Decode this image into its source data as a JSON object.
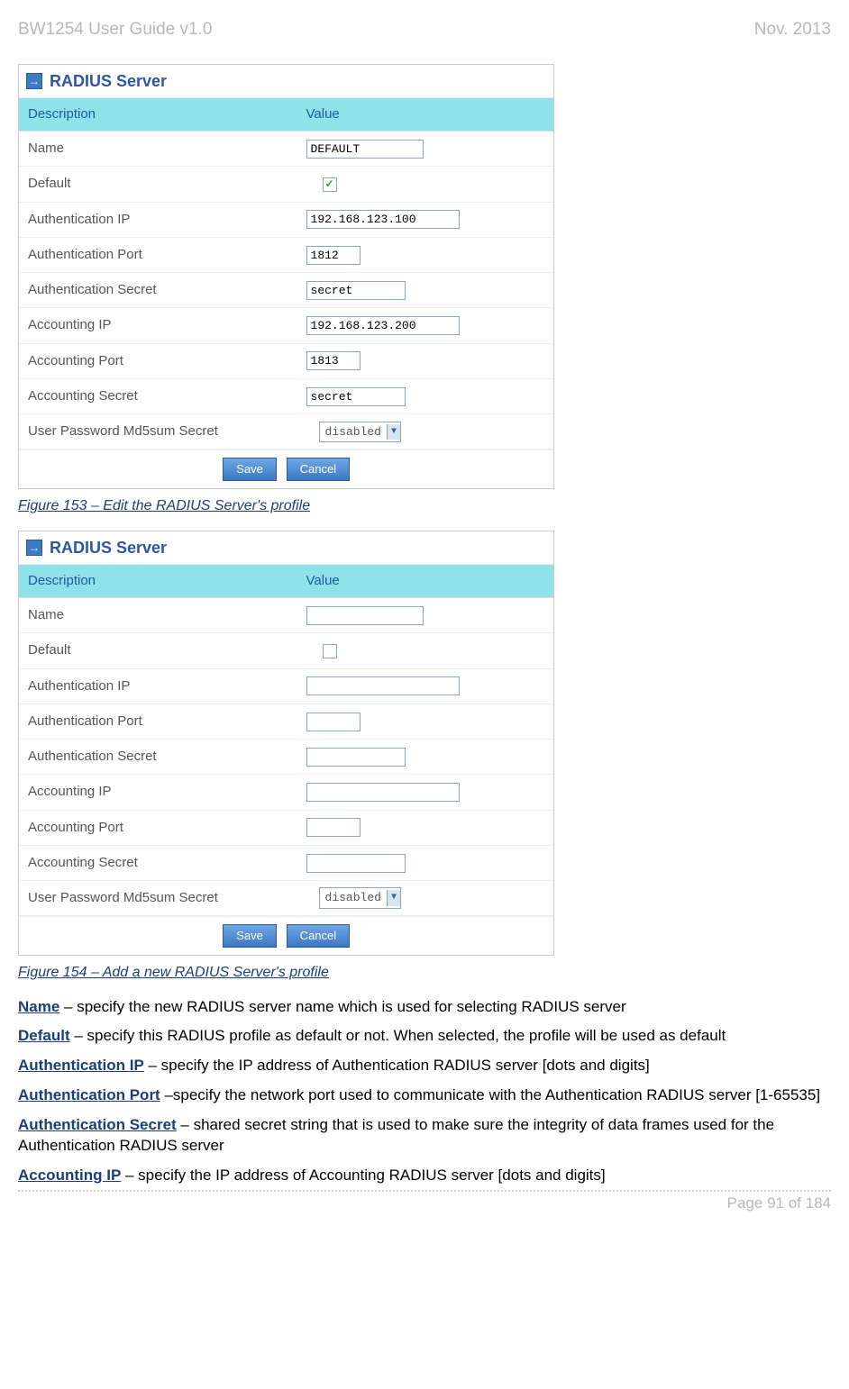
{
  "header": {
    "left": "BW1254 User Guide v1.0",
    "right": "Nov.  2013"
  },
  "footer": {
    "text": "Page 91 of 184"
  },
  "panel": {
    "title": "RADIUS Server",
    "col_desc": "Description",
    "col_val": "Value",
    "rows": {
      "name": {
        "label": "Name"
      },
      "defaultRow": {
        "label": "Default"
      },
      "auth_ip": {
        "label": "Authentication IP"
      },
      "auth_port": {
        "label": "Authentication Port"
      },
      "auth_secret": {
        "label": "Authentication Secret"
      },
      "acct_ip": {
        "label": "Accounting IP"
      },
      "acct_port": {
        "label": "Accounting Port"
      },
      "acct_secret": {
        "label": "Accounting Secret"
      },
      "md5": {
        "label": "User Password Md5sum Secret"
      }
    },
    "save": "Save",
    "cancel": "Cancel"
  },
  "form1": {
    "name": "DEFAULT",
    "default_checked": "✓",
    "auth_ip": "192.168.123.100",
    "auth_port": "1812",
    "auth_secret": "secret",
    "acct_ip": "192.168.123.200",
    "acct_port": "1813",
    "acct_secret": "secret",
    "md5": "disabled"
  },
  "form2": {
    "name": "",
    "default_checked": "",
    "auth_ip": "",
    "auth_port": "",
    "auth_secret": "",
    "acct_ip": "",
    "acct_port": "",
    "acct_secret": "",
    "md5": "disabled"
  },
  "captions": {
    "fig153": "Figure 153 – Edit the RADIUS Server's profile",
    "fig154": "Figure 154 – Add a new RADIUS Server's profile"
  },
  "body": {
    "name_term": "Name",
    "name_text": " – specify the new RADIUS server name which is used for selecting RADIUS server",
    "default_term": "Default",
    "default_text": " – specify this RADIUS profile as default or not. When selected, the profile will be used as default",
    "authip_term": "Authentication IP",
    "authip_text": " – specify the IP address of Authentication RADIUS server [dots and digits]",
    "authport_term": "Authentication Port",
    "authport_text": " –specify the network port used to communicate with the Authentication RADIUS server [1-65535]",
    "authsec_term": "Authentication Secret",
    "authsec_text": " – shared secret string that is used to make sure the integrity of data frames used for the Authentication RADIUS server",
    "acctip_term": "Accounting IP",
    "acctip_text": " – specify the IP address of Accounting RADIUS server [dots and digits]"
  }
}
